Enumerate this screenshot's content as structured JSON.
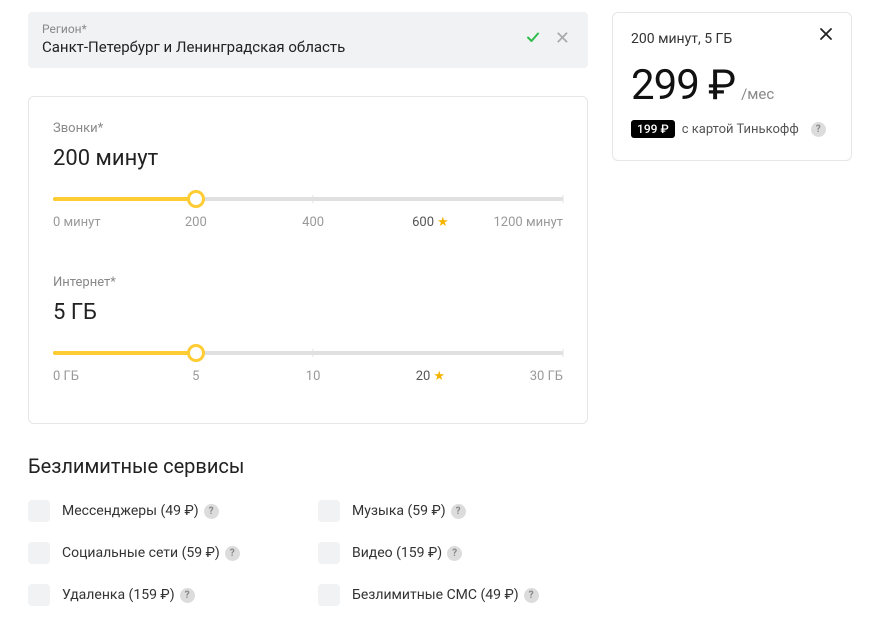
{
  "region": {
    "label": "Регион*",
    "value": "Санкт-Петербург и Ленинградская область"
  },
  "sliders": {
    "calls": {
      "label": "Звонки*",
      "value": "200 минут",
      "fill_pct": 28,
      "ticks": [
        {
          "pos": 0,
          "label": "0 минут",
          "align": "first"
        },
        {
          "pos": 28,
          "label": "200"
        },
        {
          "pos": 51,
          "label": "400"
        },
        {
          "pos": 74,
          "label": "600",
          "starred": true
        },
        {
          "pos": 100,
          "label": "1200 минут",
          "align": "last"
        }
      ]
    },
    "internet": {
      "label": "Интернет*",
      "value": "5 ГБ",
      "fill_pct": 28,
      "ticks": [
        {
          "pos": 0,
          "label": "0 ГБ",
          "align": "first"
        },
        {
          "pos": 28,
          "label": "5"
        },
        {
          "pos": 51,
          "label": "10"
        },
        {
          "pos": 74,
          "label": "20",
          "starred": true
        },
        {
          "pos": 100,
          "label": "30 ГБ",
          "align": "last"
        }
      ]
    }
  },
  "services": {
    "title": "Безлимитные сервисы",
    "items": [
      {
        "label": "Мессенджеры (49 ₽)"
      },
      {
        "label": "Музыка (59 ₽)"
      },
      {
        "label": "Социальные сети (59 ₽)"
      },
      {
        "label": "Видео (159 ₽)"
      },
      {
        "label": "Удаленка (159 ₽)"
      },
      {
        "label": "Безлимитные СМС (49 ₽)"
      }
    ]
  },
  "summary": {
    "sub": "200 минут, 5 ГБ",
    "price": "299 ₽",
    "period": "/мес",
    "discount_price": "199 ₽",
    "discount_text": "с картой Тинькофф"
  }
}
